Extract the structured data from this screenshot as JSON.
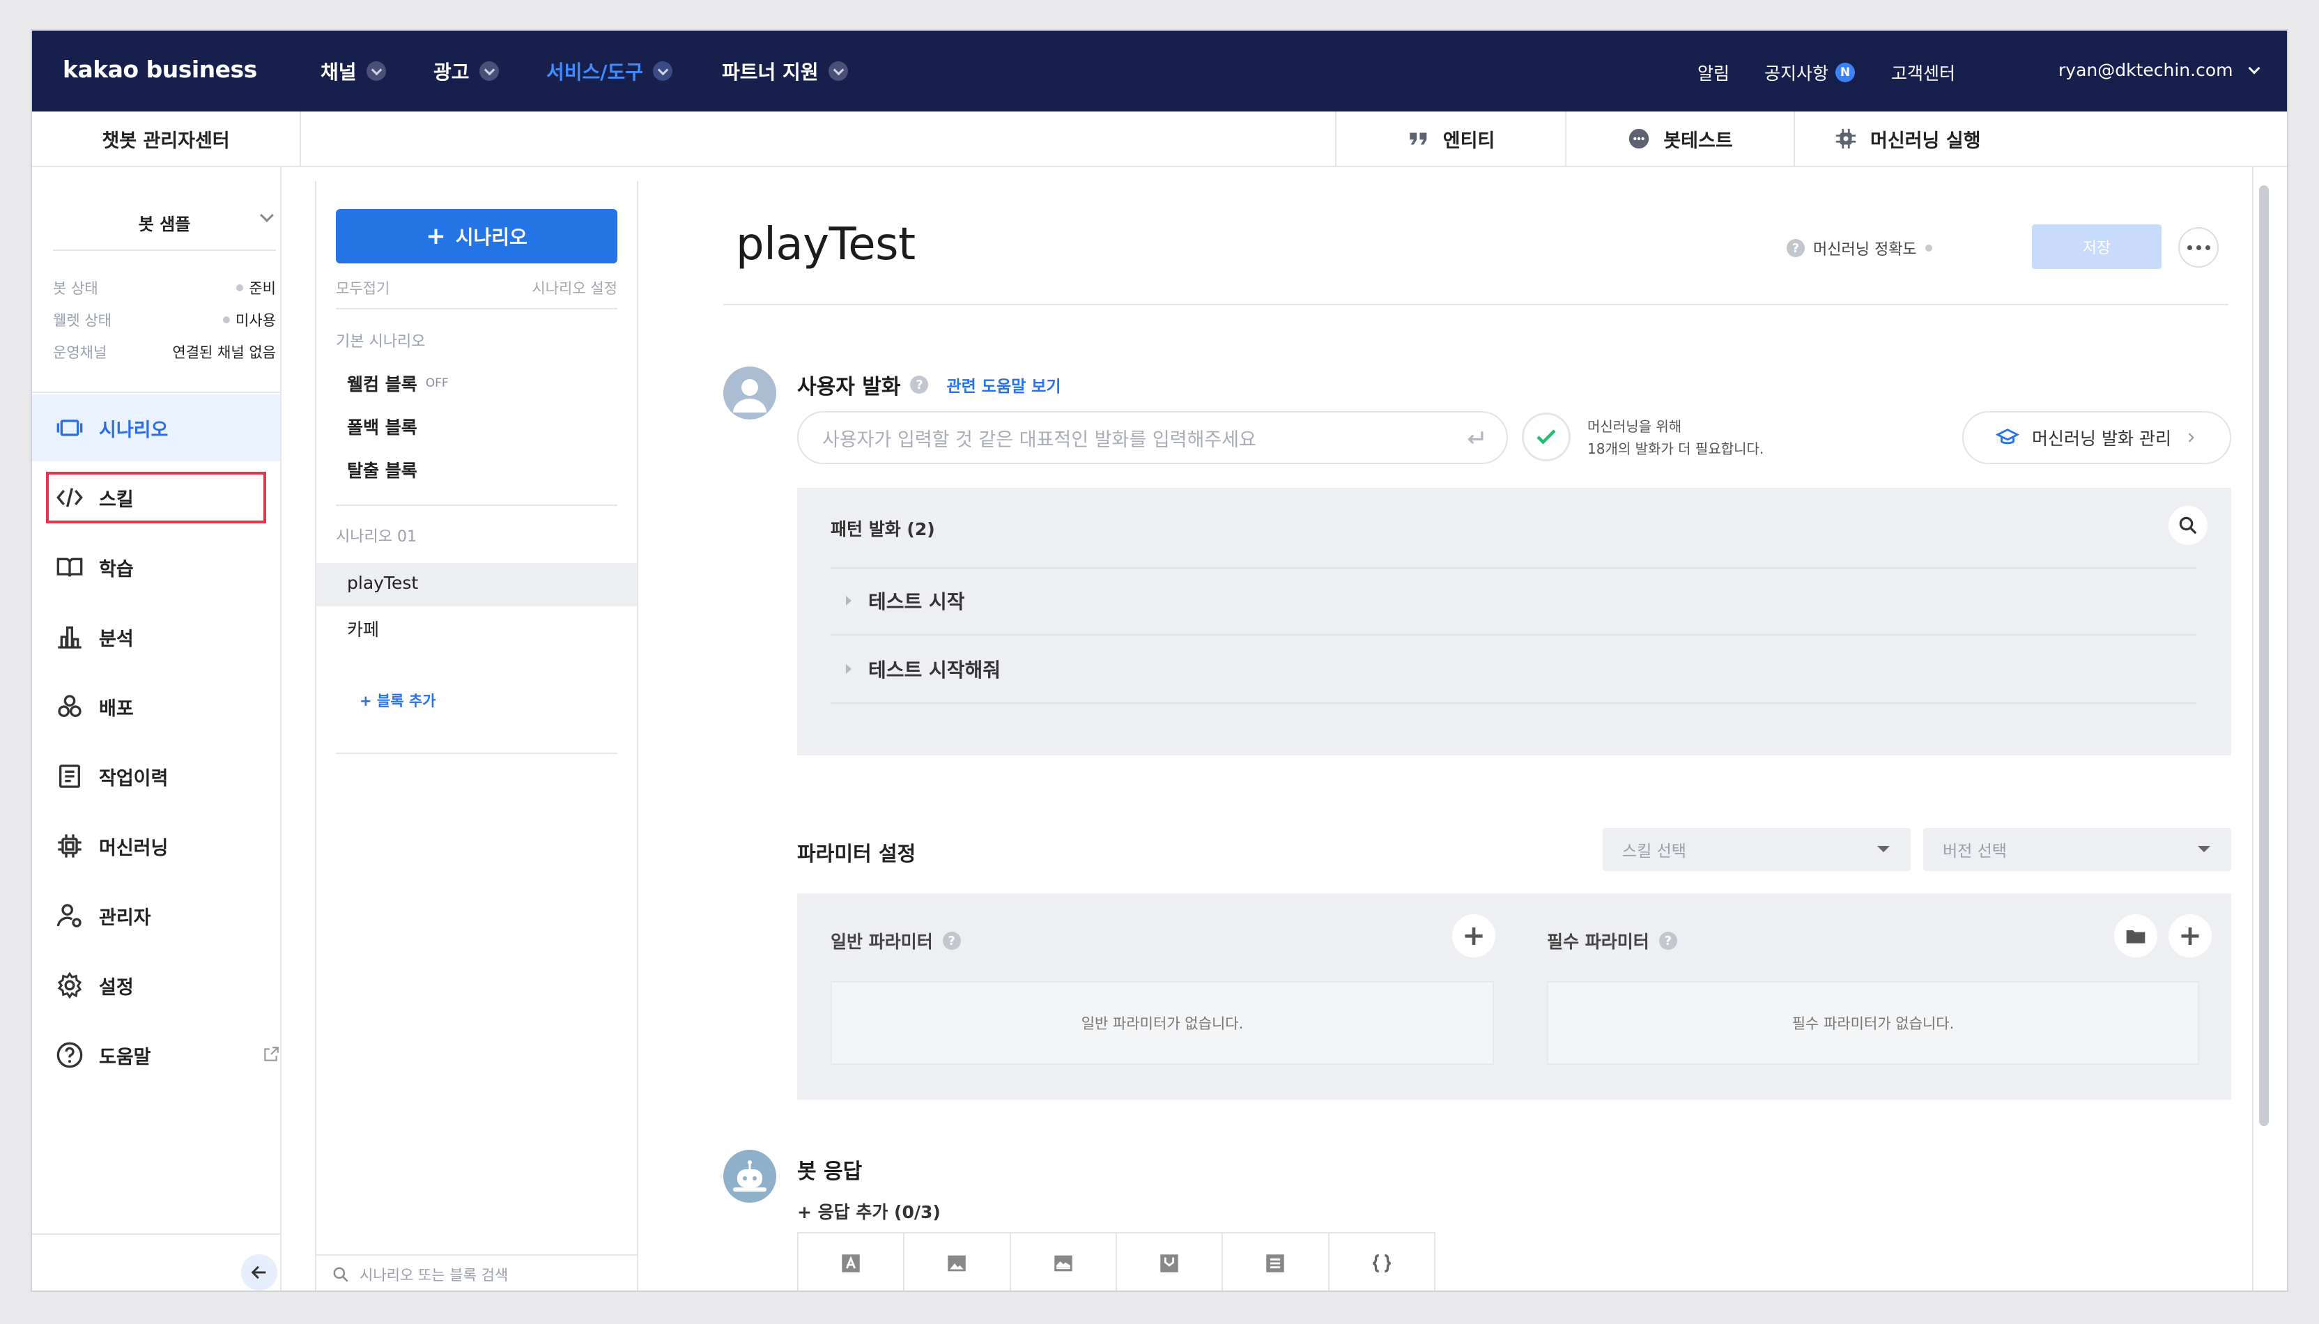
{
  "nav": {
    "logo": "kakao business",
    "menu": [
      {
        "label": "채널",
        "active": false
      },
      {
        "label": "광고",
        "active": false
      },
      {
        "label": "서비스/도구",
        "active": true
      },
      {
        "label": "파트너 지원",
        "active": false
      }
    ],
    "alerts": "알림",
    "notice": "공지사항",
    "notice_badge": "N",
    "support": "고객센터",
    "user": "ryan@dktechin.com"
  },
  "subheader": {
    "title": "챗봇 관리자센터",
    "tools": [
      {
        "label": "엔티티",
        "icon": "quote-icon"
      },
      {
        "label": "봇테스트",
        "icon": "chat-bubble-icon"
      },
      {
        "label": "머신러닝 실행",
        "icon": "chip-gear-icon"
      }
    ]
  },
  "sidebar": {
    "bot_name": "봇 샘플",
    "status": [
      {
        "key": "봇 상태",
        "value": "준비"
      },
      {
        "key": "웰렛 상태",
        "value": "미사용"
      },
      {
        "key": "운영채널",
        "value": "연결된 채널 없음"
      }
    ],
    "items": [
      {
        "label": "시나리오",
        "icon": "scenario-icon",
        "selected": true
      },
      {
        "label": "스킬",
        "icon": "code-icon",
        "selected": false
      },
      {
        "label": "학습",
        "icon": "book-icon",
        "selected": false
      },
      {
        "label": "분석",
        "icon": "bar-chart-icon",
        "selected": false
      },
      {
        "label": "배포",
        "icon": "deploy-icon",
        "selected": false
      },
      {
        "label": "작업이력",
        "icon": "history-icon",
        "selected": false
      },
      {
        "label": "머신러닝",
        "icon": "chip-icon",
        "selected": false
      },
      {
        "label": "관리자",
        "icon": "admin-icon",
        "selected": false
      },
      {
        "label": "설정",
        "icon": "gear-icon",
        "selected": false
      },
      {
        "label": "도움말",
        "icon": "help-icon",
        "selected": false
      }
    ]
  },
  "scenario": {
    "add_label": "시나리오",
    "collapse_all": "모두접기",
    "settings": "시나리오 설정",
    "groups": [
      {
        "title": "기본 시나리오",
        "blocks": [
          {
            "label": "웰컴 블록",
            "tag": "OFF"
          },
          {
            "label": "폴백 블록",
            "tag": ""
          },
          {
            "label": "탈출 블록",
            "tag": ""
          }
        ]
      },
      {
        "title": "시나리오 01",
        "blocks": [
          {
            "label": "playTest",
            "tag": ""
          },
          {
            "label": "카페",
            "tag": ""
          }
        ]
      }
    ],
    "add_block": "+ 블록 추가",
    "search_placeholder": "시나리오 또는 블록 검색"
  },
  "main": {
    "title": "playTest",
    "ml_accuracy": "머신러닝 정확도",
    "save": "저장",
    "user_utterance": {
      "title": "사용자 발화",
      "help_link": "관련 도움말 보기",
      "placeholder": "사용자가 입력할 것 같은 대표적인 발화를 입력해주세요",
      "ml_need_line1": "머신러닝을 위해",
      "ml_need_line2": "18개의 발화가 더 필요합니다.",
      "ml_manage": "머신러닝 발화 관리"
    },
    "patterns": {
      "title": "패턴 발화 (2)",
      "items": [
        "테스트 시작",
        "테스트 시작해줘"
      ]
    },
    "params": {
      "title": "파라미터 설정",
      "skill_select": "스킬 선택",
      "version_select": "버전 선택",
      "general_title": "일반 파라미터",
      "general_empty": "일반 파라미터가 없습니다.",
      "required_title": "필수 파라미터",
      "required_empty": "필수 파라미터가 없습니다."
    },
    "bot_response": {
      "title": "봇 응답",
      "add": "+ 응답 추가 (0/3)",
      "types": [
        "text-type-icon",
        "image-type-icon",
        "card-type-icon",
        "commerce-type-icon",
        "list-type-icon",
        "code-type-icon"
      ]
    }
  },
  "colors": {
    "nav_bg": "#17204c",
    "accent": "#2574e6",
    "active_menu": "#3f8dff",
    "highlight": "#e2364a"
  }
}
